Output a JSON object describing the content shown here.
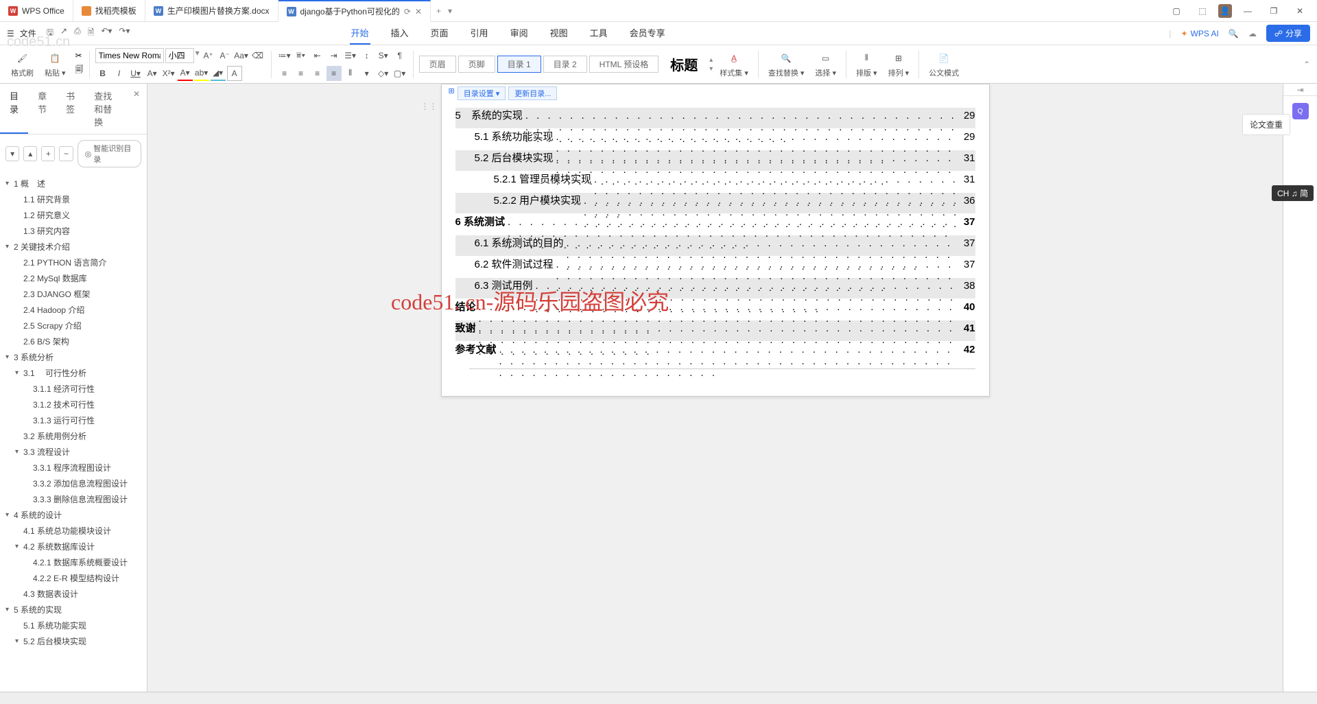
{
  "tabs": {
    "wps": "WPS Office",
    "templates": "找稻壳模板",
    "doc1": "生产印模图片替换方案.docx",
    "doc2": "django基于Python可视化的"
  },
  "file_label": "文件",
  "menu": {
    "start": "开始",
    "insert": "插入",
    "page": "页面",
    "reference": "引用",
    "review": "审阅",
    "view": "视图",
    "tools": "工具",
    "member": "会员专享"
  },
  "wps_ai": "WPS AI",
  "search_icon": "Q",
  "share": "分享",
  "ribbon": {
    "format_painter": "格式刷",
    "paste": "粘贴 ▾",
    "font_name": "Times New Roma",
    "font_size": "小四",
    "header": "页眉",
    "footer": "页脚",
    "toc1": "目录 1",
    "toc2": "目录 2",
    "html": "HTML 预设格",
    "title": "标题",
    "style_set": "样式集 ▾",
    "find_replace": "查找替换 ▾",
    "select": "选择 ▾",
    "arrange": "排版 ▾",
    "sort": "排列 ▾",
    "public_mode": "公文模式"
  },
  "sidebar": {
    "tabs": {
      "toc": "目录",
      "chapter": "章节",
      "bookmark": "书签",
      "find": "查找和替换"
    },
    "smart": "智能识别目录"
  },
  "outline": [
    {
      "lvl": 0,
      "caret": "▾",
      "n": "1",
      "t": "概　述"
    },
    {
      "lvl": 1,
      "caret": "",
      "n": "1.1",
      "t": "研究背景"
    },
    {
      "lvl": 1,
      "caret": "",
      "n": "1.2",
      "t": "研究意义"
    },
    {
      "lvl": 1,
      "caret": "",
      "n": "1.3",
      "t": "研究内容"
    },
    {
      "lvl": 0,
      "caret": "▾",
      "n": "2",
      "t": "关键技术介绍"
    },
    {
      "lvl": 1,
      "caret": "",
      "n": "2.1",
      "t": "PYTHON 语言简介"
    },
    {
      "lvl": 1,
      "caret": "",
      "n": "2.2",
      "t": "MySql 数据库"
    },
    {
      "lvl": 1,
      "caret": "",
      "n": "2.3",
      "t": "DJANGO 框架"
    },
    {
      "lvl": 1,
      "caret": "",
      "n": "2.4",
      "t": "Hadoop 介绍"
    },
    {
      "lvl": 1,
      "caret": "",
      "n": "2.5",
      "t": "Scrapy 介绍"
    },
    {
      "lvl": 1,
      "caret": "",
      "n": "2.6",
      "t": "B/S 架构"
    },
    {
      "lvl": 0,
      "caret": "▾",
      "n": "3",
      "t": "系统分析"
    },
    {
      "lvl": 1,
      "caret": "▾",
      "n": "3.1",
      "t": "　可行性分析"
    },
    {
      "lvl": 2,
      "caret": "",
      "n": "3.1.1",
      "t": "经济可行性"
    },
    {
      "lvl": 2,
      "caret": "",
      "n": "3.1.2",
      "t": "技术可行性"
    },
    {
      "lvl": 2,
      "caret": "",
      "n": "3.1.3",
      "t": "运行可行性"
    },
    {
      "lvl": 1,
      "caret": "",
      "n": "3.2",
      "t": "系统用例分析"
    },
    {
      "lvl": 1,
      "caret": "▾",
      "n": "3.3",
      "t": "流程设计"
    },
    {
      "lvl": 2,
      "caret": "",
      "n": "3.3.1",
      "t": "程序流程图设计"
    },
    {
      "lvl": 2,
      "caret": "",
      "n": "3.3.2",
      "t": "添加信息流程图设计"
    },
    {
      "lvl": 2,
      "caret": "",
      "n": "3.3.3",
      "t": "删除信息流程图设计"
    },
    {
      "lvl": 0,
      "caret": "▾",
      "n": "4",
      "t": "系统的设计"
    },
    {
      "lvl": 1,
      "caret": "",
      "n": "4.1",
      "t": "系统总功能模块设计"
    },
    {
      "lvl": 1,
      "caret": "▾",
      "n": "4.2",
      "t": "系统数据库设计"
    },
    {
      "lvl": 2,
      "caret": "",
      "n": "4.2.1",
      "t": "数据库系统概要设计"
    },
    {
      "lvl": 2,
      "caret": "",
      "n": "4.2.2",
      "t": "E-R 模型结构设计"
    },
    {
      "lvl": 1,
      "caret": "",
      "n": "4.3",
      "t": "数据表设计"
    },
    {
      "lvl": 0,
      "caret": "▾",
      "n": "5",
      "t": "系统的实现"
    },
    {
      "lvl": 1,
      "caret": "",
      "n": "5.1",
      "t": "系统功能实现"
    },
    {
      "lvl": 1,
      "caret": "▾",
      "n": "5.2",
      "t": "后台模块实现"
    }
  ],
  "doc_tools": {
    "settings": "目录设置 ▾",
    "update": "更新目录..."
  },
  "toc": [
    {
      "indent": 0,
      "t": "5　系统的实现",
      "p": "29",
      "bg": 1
    },
    {
      "indent": 1,
      "t": "5.1 系统功能实现",
      "p": "29",
      "bg": 0
    },
    {
      "indent": 1,
      "t": "5.2 后台模块实现",
      "p": "31",
      "bg": 1
    },
    {
      "indent": 2,
      "t": "5.2.1 管理员模块实现",
      "p": "31",
      "bg": 0
    },
    {
      "indent": 2,
      "t": "5.2.2 用户模块实现",
      "p": "36",
      "bg": 1
    },
    {
      "indent": 0,
      "t": "6 系统测试",
      "p": "37",
      "bg": 0,
      "bold": 1
    },
    {
      "indent": 1,
      "t": "6.1 系统测试的目的",
      "p": "37",
      "bg": 1
    },
    {
      "indent": 1,
      "t": "6.2 软件测试过程",
      "p": "37",
      "bg": 0
    },
    {
      "indent": 1,
      "t": "6.3 测试用例",
      "p": "38",
      "bg": 1
    },
    {
      "indent": 0,
      "t": "结论",
      "p": "40",
      "bg": 0,
      "bold": 1
    },
    {
      "indent": 0,
      "t": "致谢",
      "p": "41",
      "bg": 1,
      "bold": 1
    },
    {
      "indent": 0,
      "t": "参考文献",
      "p": "42",
      "bg": 0,
      "bold": 1
    }
  ],
  "right_pane": {
    "paper_check": "论文查重"
  },
  "redtext": "code51. cn-源码乐园盗图必究",
  "watermark": "code51.cn",
  "ime": "CH ♫ 简"
}
